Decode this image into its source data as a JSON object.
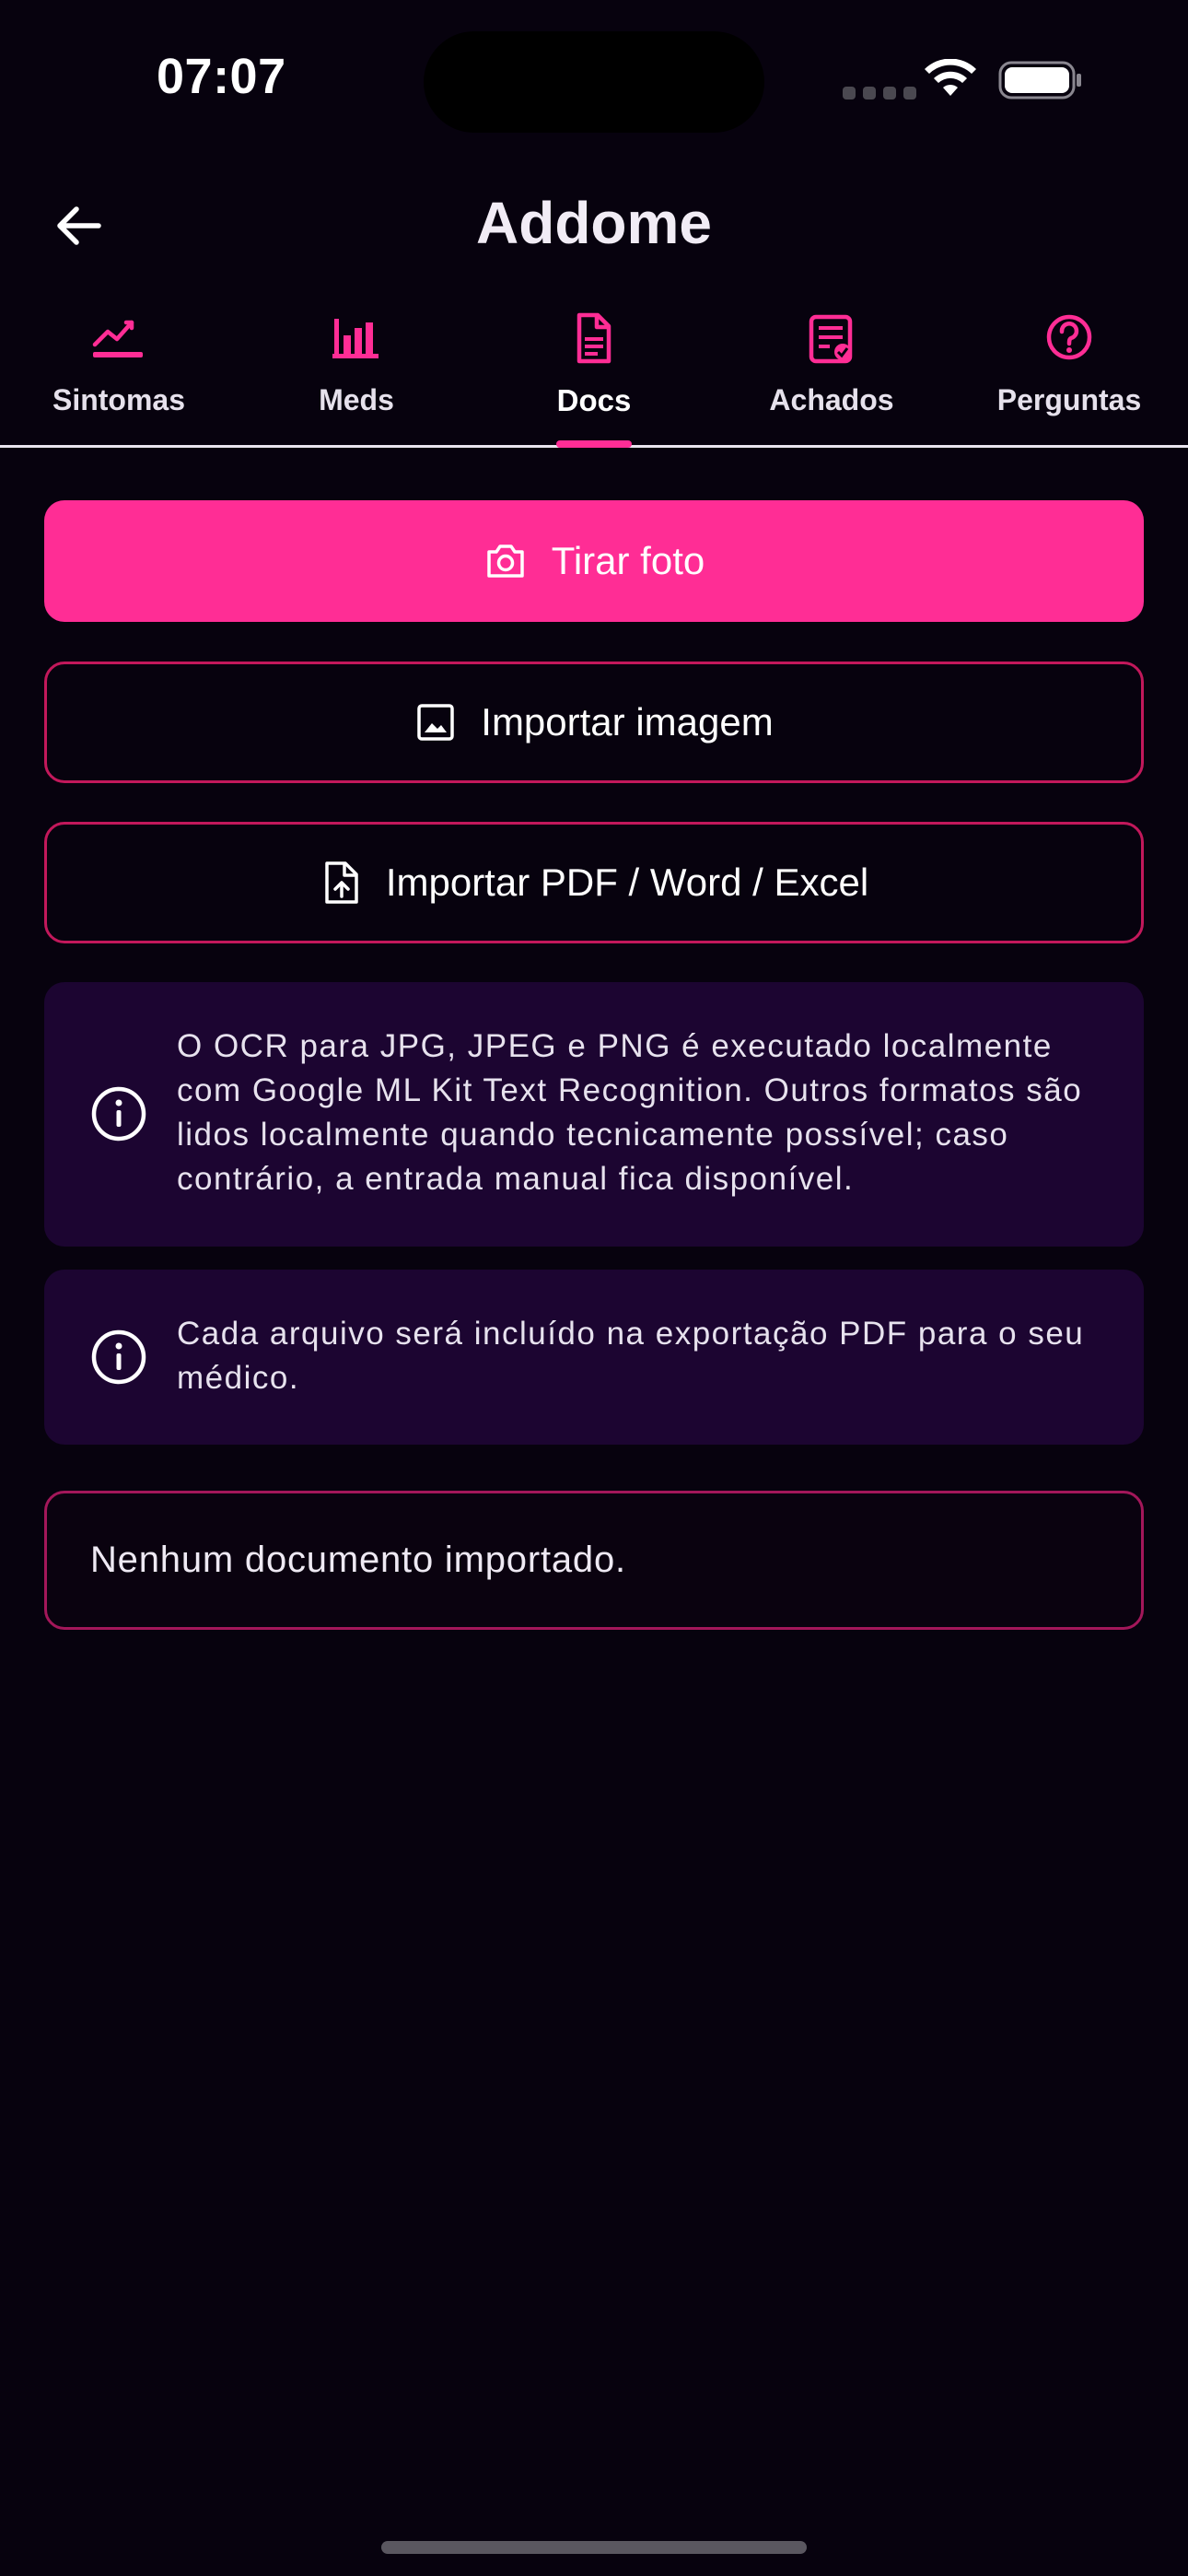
{
  "status_bar": {
    "time": "07:07",
    "icons": [
      "cellular-signal-icon",
      "wifi-icon",
      "battery-icon"
    ]
  },
  "header": {
    "title": "Addome",
    "back_icon": "arrow-left-icon"
  },
  "tabs": [
    {
      "label": "Sintomas",
      "icon": "trend-chart-icon",
      "active": false
    },
    {
      "label": "Meds",
      "icon": "bar-chart-icon",
      "active": false
    },
    {
      "label": "Docs",
      "icon": "document-icon",
      "active": true
    },
    {
      "label": "Achados",
      "icon": "clipboard-check-icon",
      "active": false
    },
    {
      "label": "Perguntas",
      "icon": "help-circle-icon",
      "active": false
    }
  ],
  "actions": {
    "take_photo": "Tirar foto",
    "import_image": "Importar imagem",
    "import_document": "Importar PDF / Word / Excel"
  },
  "info": {
    "ocr_note": "O OCR para JPG, JPEG e PNG é executado localmente com Google ML Kit Text Recognition. Outros formatos são lidos localmente quando tecnicamente possível; caso contrário, a entrada manual fica disponível.",
    "export_note": "Cada arquivo será incluído na exportação PDF para o seu médico."
  },
  "documents": {
    "empty_message": "Nenhum documento importado."
  },
  "colors": {
    "background": "#07020e",
    "accent": "#ff2d95",
    "card": "#1c0531",
    "outline": "#c2185b"
  }
}
